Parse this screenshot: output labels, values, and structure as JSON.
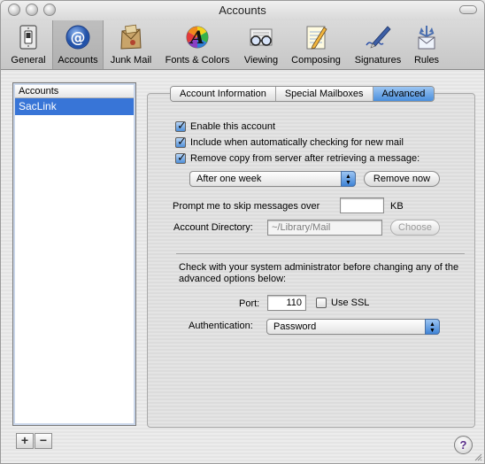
{
  "window": {
    "title": "Accounts"
  },
  "toolbar": {
    "items": [
      {
        "label": "General",
        "icon": "light-switch-icon"
      },
      {
        "label": "Accounts",
        "icon": "at-sign-icon"
      },
      {
        "label": "Junk Mail",
        "icon": "junk-mail-icon"
      },
      {
        "label": "Fonts & Colors",
        "icon": "fonts-colors-icon"
      },
      {
        "label": "Viewing",
        "icon": "eyeglasses-icon"
      },
      {
        "label": "Composing",
        "icon": "notepad-pencil-icon"
      },
      {
        "label": "Signatures",
        "icon": "pen-signature-icon"
      },
      {
        "label": "Rules",
        "icon": "rules-envelope-icon"
      }
    ],
    "selected": "Accounts"
  },
  "accounts_list": {
    "header": "Accounts",
    "items": [
      "SacLink"
    ],
    "selected": "SacLink"
  },
  "list_buttons": {
    "add": "+",
    "remove": "−"
  },
  "tabs": {
    "items": [
      "Account Information",
      "Special Mailboxes",
      "Advanced"
    ],
    "active": "Advanced"
  },
  "advanced": {
    "enable_account": {
      "label": "Enable this account",
      "checked": true
    },
    "include_checking": {
      "label": "Include when automatically checking for new mail",
      "checked": true
    },
    "remove_copy": {
      "label": "Remove copy from server after retrieving a message:",
      "checked": true
    },
    "remove_when": {
      "value": "After one week"
    },
    "remove_now_button": "Remove now",
    "skip_prompt": {
      "label": "Prompt me to skip messages over",
      "value": "",
      "unit": "KB"
    },
    "account_directory": {
      "label": "Account Directory:",
      "value": "~/Library/Mail",
      "choose_button": "Choose"
    },
    "admin_note": "Check with your system administrator before changing any of the advanced options below:",
    "port": {
      "label": "Port:",
      "value": "110"
    },
    "use_ssl": {
      "label": "Use SSL",
      "checked": false
    },
    "authentication": {
      "label": "Authentication:",
      "value": "Password"
    }
  },
  "help_button": "?"
}
